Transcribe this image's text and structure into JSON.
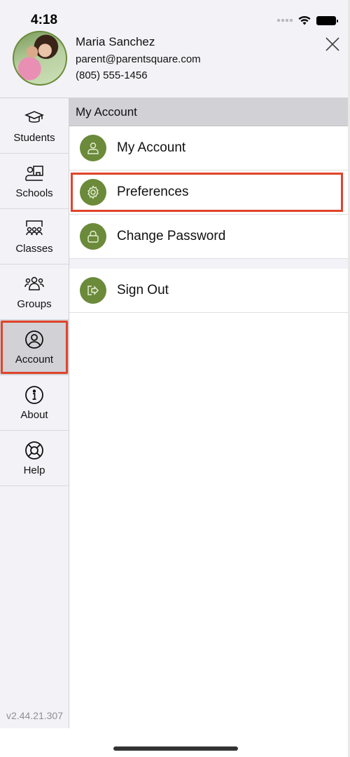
{
  "status_bar": {
    "time": "4:18"
  },
  "profile": {
    "name": "Maria Sanchez",
    "email": "parent@parentsquare.com",
    "phone": "(805) 555-1456"
  },
  "sidebar": {
    "items": [
      {
        "label": "Students",
        "icon": "graduation-cap-icon",
        "active": false
      },
      {
        "label": "Schools",
        "icon": "school-teacher-icon",
        "active": false
      },
      {
        "label": "Classes",
        "icon": "classroom-icon",
        "active": false
      },
      {
        "label": "Groups",
        "icon": "group-icon",
        "active": false
      },
      {
        "label": "Account",
        "icon": "user-circle-icon",
        "active": true
      },
      {
        "label": "About",
        "icon": "info-icon",
        "active": false
      },
      {
        "label": "Help",
        "icon": "lifebuoy-icon",
        "active": false
      }
    ],
    "version": "v2.44.21.307"
  },
  "main": {
    "section_title": "My Account",
    "items": [
      {
        "label": "My Account",
        "icon": "user-icon"
      },
      {
        "label": "Preferences",
        "icon": "gear-icon",
        "highlighted": true
      },
      {
        "label": "Change Password",
        "icon": "lock-icon"
      }
    ],
    "secondary_items": [
      {
        "label": "Sign Out",
        "icon": "sign-out-icon"
      }
    ]
  },
  "colors": {
    "accent": "#6b8a3a",
    "highlight": "#e0442b",
    "sidebar_bg": "#f2f2f7",
    "active_bg": "#d1d1d6"
  }
}
